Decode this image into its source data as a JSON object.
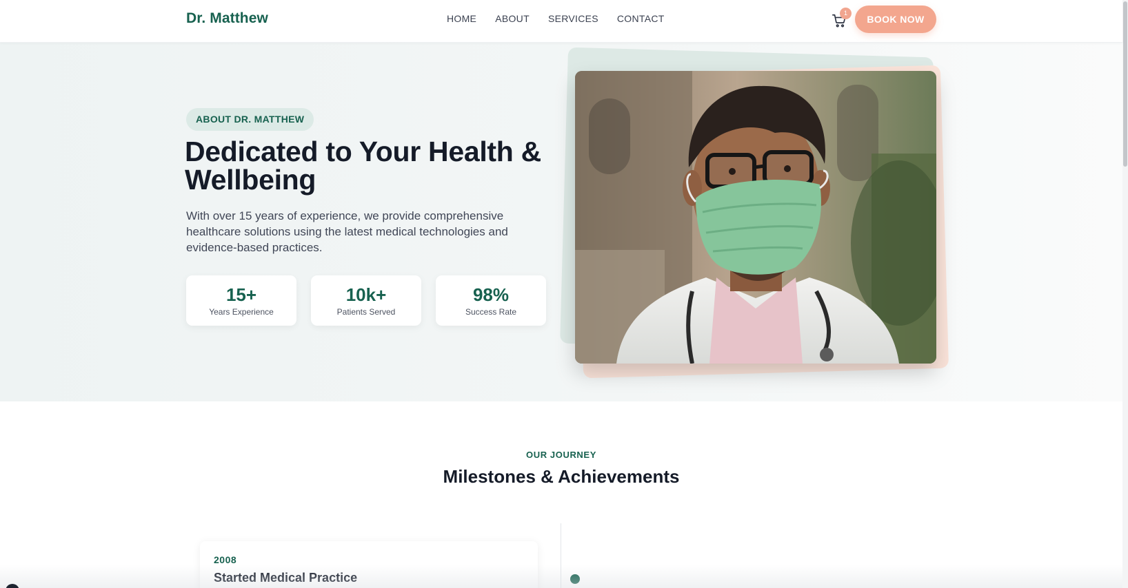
{
  "nav": {
    "brand": "Dr. Matthew",
    "links": [
      "HOME",
      "ABOUT",
      "SERVICES",
      "CONTACT"
    ],
    "cart_count": "1",
    "cta": "BOOK NOW"
  },
  "hero": {
    "eyebrow": "ABOUT DR. MATTHEW",
    "title": "Dedicated to Your Health & Wellbeing",
    "description": "With over 15 years of experience, we provide comprehensive healthcare solutions using the latest medical technologies and evidence-based practices.",
    "stats": [
      {
        "value": "15+",
        "label": "Years Experience"
      },
      {
        "value": "10k+",
        "label": "Patients Served"
      },
      {
        "value": "98%",
        "label": "Success Rate"
      }
    ],
    "photo_alt": "Doctor wearing a green surgical mask and glasses"
  },
  "journey": {
    "eyebrow": "OUR JOURNEY",
    "title": "Milestones & Achievements",
    "milestones": [
      {
        "year": "2008",
        "title": "Started Medical Practice"
      }
    ]
  },
  "colors": {
    "brand_green": "#17614f",
    "accent_peach": "#f3a68e",
    "pill_bg": "#dceae6"
  },
  "icons": {
    "cart": "shopping-cart-icon",
    "timeline_dot": "timeline-dot-icon"
  }
}
